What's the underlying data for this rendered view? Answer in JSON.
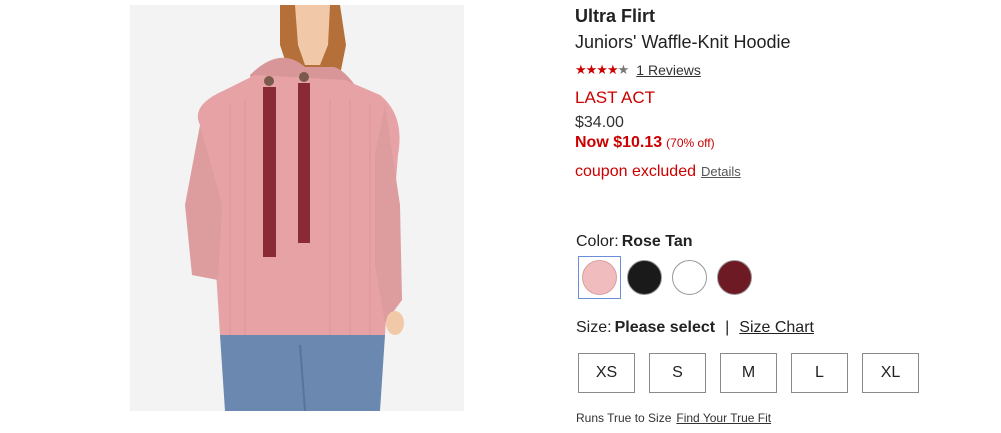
{
  "product": {
    "brand": "Ultra Flirt",
    "name": "Juniors' Waffle-Knit Hoodie",
    "rating": 4.5,
    "reviews_label": "1 Reviews",
    "event_label": "LAST ACT",
    "original_price": "$34.00",
    "sale_price": "Now $10.13",
    "discount": "(70% off)",
    "coupon_text": "coupon excluded",
    "coupon_details": "Details"
  },
  "color": {
    "label": "Color:",
    "selected": "Rose Tan",
    "swatches": [
      {
        "name": "Rose Tan",
        "color": "#f1bcbe",
        "selected": true
      },
      {
        "name": "Black",
        "color": "#1a1a1a",
        "selected": false
      },
      {
        "name": "White",
        "color": "#ffffff",
        "selected": false
      },
      {
        "name": "Burgundy",
        "color": "#6e1a24",
        "selected": false
      }
    ]
  },
  "size": {
    "label": "Size:",
    "selected": "Please select",
    "separator": "|",
    "chart_link": "Size Chart",
    "options": [
      "XS",
      "S",
      "M",
      "L",
      "XL"
    ]
  },
  "fit": {
    "text": "Runs True to Size",
    "link": "Find Your True Fit"
  },
  "colors": {
    "accent_red": "#cc0000",
    "selected_border": "#6a8fd8"
  }
}
